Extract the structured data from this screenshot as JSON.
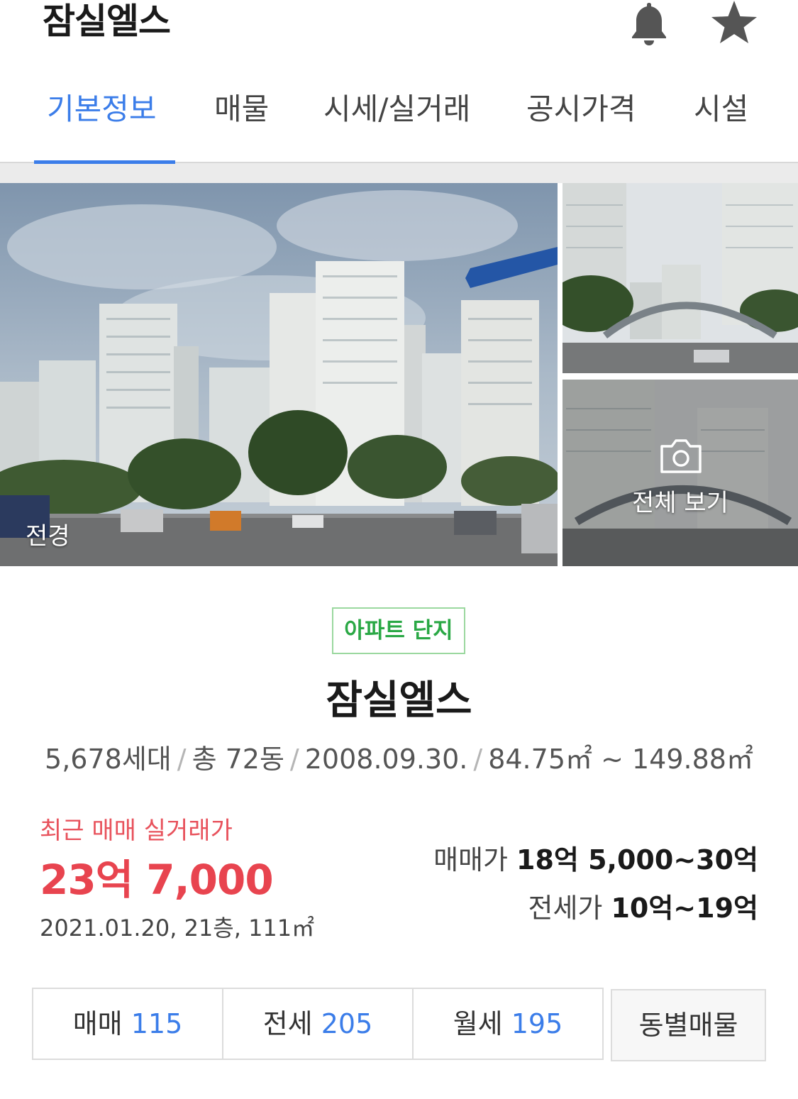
{
  "header": {
    "title": "잠실엘스",
    "alarm_icon": "bell-icon",
    "favorite_icon": "star-icon"
  },
  "tabs": [
    {
      "label": "기본정보",
      "active": true
    },
    {
      "label": "매물",
      "active": false
    },
    {
      "label": "시세/실거래",
      "active": false
    },
    {
      "label": "공시가격",
      "active": false
    },
    {
      "label": "시설",
      "active": false
    }
  ],
  "photos": {
    "main_label": "전경",
    "view_all_label": "전체 보기",
    "view_all_icon": "camera-icon"
  },
  "complex": {
    "badge": "아파트 단지",
    "name": "잠실엘스",
    "households": "5,678세대",
    "buildings": "총 72동",
    "approval_date": "2008.09.30.",
    "area_range": "84.75㎡ ~ 149.88㎡"
  },
  "recent_trade": {
    "label": "최근 매매 실거래가",
    "price": "23억 7,000",
    "detail": "2021.01.20, 21층, 111㎡"
  },
  "price_ranges": {
    "sale_label": "매매가",
    "sale_value": "18억 5,000~30억",
    "jeonse_label": "전세가",
    "jeonse_value": "10억~19억"
  },
  "listing_buttons": {
    "sale_label": "매매",
    "sale_count": "115",
    "jeonse_label": "전세",
    "jeonse_count": "205",
    "monthly_label": "월세",
    "monthly_count": "195",
    "by_building_label": "동별매물"
  },
  "colors": {
    "accent_blue": "#3b7de9",
    "price_red": "#e8444f",
    "badge_green": "#2aa845"
  }
}
